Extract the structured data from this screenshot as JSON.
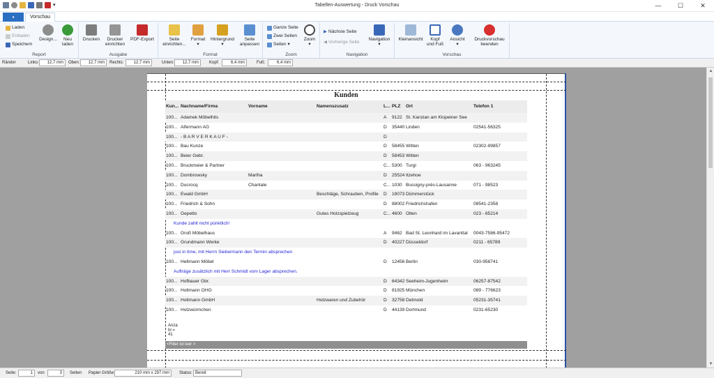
{
  "window": {
    "title": "Tabellen-Auswertung - Druck Vorschau",
    "file_tab": "",
    "tab": "Vorschau"
  },
  "ribbon": {
    "report": {
      "label": "Report",
      "laden": "Laden",
      "entladen": "Entladen",
      "speichern": "Speichern",
      "design": "Design...",
      "neu": "Neu laden"
    },
    "ausgabe": {
      "label": "Ausgabe",
      "drucken": "Drucken",
      "drucker": "Drucker einrichten",
      "pdf": "PDF-Export"
    },
    "format": {
      "label": "Format",
      "seite": "Seite einrichten...",
      "format": "Format",
      "hintergrund": "Hintergrund",
      "anpassen": "Seite anpassen"
    },
    "zoom": {
      "label": "Zoom",
      "ganze": "Ganze Seite",
      "zwei": "Zwei Seiten",
      "seiten": "Seiten",
      "zoom": "Zoom"
    },
    "navigation": {
      "label": "Navigation",
      "naechste": "Nächste Seite",
      "vorherige": "Vorherige Seite",
      "navigation": "Navigation"
    },
    "vorschau": {
      "label": "Vorschau",
      "klein": "Kleinansicht",
      "kopf": "Kopf und Fuß",
      "ansicht": "Ansicht",
      "beenden": "Druckvorschau beenden"
    }
  },
  "margins": {
    "raender": "Ränder",
    "links_l": "Links:",
    "links": "12,7 mm",
    "oben_l": "Oben:",
    "oben": "12,7 mm",
    "rechts_l": "Rechts:",
    "rechts": "12,7 mm",
    "unten_l": "Unten:",
    "unten": "12,7 mm",
    "kopf_l": "Kopf:",
    "kopf": "6,4 mm",
    "fuss_l": "Fuß:",
    "fuss": "6,4 mm"
  },
  "report": {
    "title": "Kunden",
    "headers": [
      "Kun...",
      "Nachname/Firma",
      "Vorname",
      "Namenszusatz",
      "L...",
      "PLZ",
      "Ort",
      "Telefon 1"
    ],
    "rows": [
      [
        "100...",
        "Adamek Möbelhits",
        "",
        "",
        "A",
        "9122",
        "St. Kanzian am Klopeiner See",
        ""
      ],
      [
        "100...",
        "Alfermann AG",
        "",
        "",
        "D",
        "35440",
        "Linden",
        "02541-56325"
      ],
      [
        "100...",
        "- B A R V E R K A U F -",
        "",
        "",
        "D",
        "",
        "",
        ""
      ],
      [
        "100...",
        "Bau Kunze",
        "",
        "",
        "D",
        "58455",
        "Witten",
        "02302-99857"
      ],
      [
        "100...",
        "Beier Gebr.",
        "",
        "",
        "D",
        "58453",
        "Witten",
        ""
      ],
      [
        "100...",
        "Bruckmeier & Partner",
        "",
        "",
        "C...",
        "5300",
        "Turgi",
        "063 - 963245"
      ],
      [
        "100...",
        "Dombrowsky",
        "Martha",
        "",
        "D",
        "25524",
        "Itzehoe",
        ""
      ],
      [
        "100...",
        "Ducrocq",
        "Chantale",
        "",
        "C...",
        "1030",
        "Bussigny-près-Lausanne",
        "071 - 98523"
      ],
      [
        "100...",
        "Ewald GmbH",
        "",
        "Beschläge, Schrauben, Profile",
        "D",
        "19073",
        "Dümmerstück",
        ""
      ],
      [
        "100...",
        "Friedrich & Sohn",
        "",
        "",
        "D",
        "88002",
        "Friedrichshafen",
        "08541-2358"
      ],
      [
        "100...",
        "Gepetto",
        "",
        "Gutes Holzspielzeug",
        "C...",
        "4600",
        "Olten",
        "023 - 65214"
      ],
      {
        "note": "Kunde zahlt nicht pünktlich!"
      },
      [
        "100...",
        "Groß Möbelhaus",
        "",
        "",
        "A",
        "9462",
        "Bad St. Leonhard im Lavanttal",
        "0043-7586-95472"
      ],
      [
        "100...",
        "Grundmann Werke",
        "",
        "",
        "D",
        "40227",
        "Düsseldorf",
        "0211 - 65789"
      ],
      {
        "note": "just in time, mit Herrn Siebermann den Termin absprechen"
      },
      [
        "100...",
        "Hellmann Möbel",
        "",
        "",
        "D",
        "12456",
        "Berlin",
        "030-958741"
      ],
      {
        "note": "Aufträge zusätzlich mit Herr Schmidt vom Lager absprechen."
      },
      [
        "100...",
        "Hofbauer Gbr.",
        "",
        "",
        "D",
        "64342",
        "Seeheim-Jugenheim",
        "06257-87542"
      ],
      [
        "100...",
        "Hollmann OHG",
        "",
        "",
        "D",
        "81925",
        "München",
        "089 - 776623"
      ],
      [
        "100...",
        "Holtmann GmbH",
        "",
        "Holzwaren und Zubehör",
        "D",
        "32758",
        "Detmold",
        "05231-35741"
      ],
      [
        "100...",
        "Holzwürmchen",
        "",
        "",
        "D",
        "44139",
        "Dortmund",
        "0231-65230"
      ]
    ],
    "anzahl": [
      "Anza",
      "hl =",
      "41"
    ],
    "filter": "<Filter ist leer >"
  },
  "status": {
    "seite_l": "Seite:",
    "seite": "1",
    "von_l": "von",
    "von": "3",
    "seiten_l": "Seiten",
    "papier_l": "Papier Größe:",
    "papier": "210 mm x 297 mm",
    "status_l": "Status:",
    "status": "Bereit"
  },
  "colors": {
    "accent": "#2b6fc2",
    "note": "#1f1fd6"
  }
}
